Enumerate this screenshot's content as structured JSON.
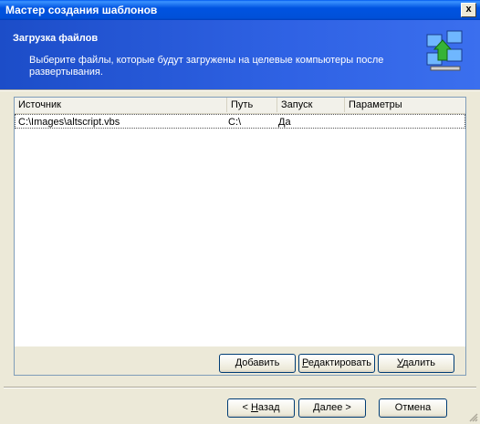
{
  "window": {
    "title": "Мастер создания шаблонов",
    "close_label": "x"
  },
  "header": {
    "title": "Загрузка файлов",
    "description": "Выберите файлы, которые будут загружены на целевые компьютеры после развертывания."
  },
  "table": {
    "columns": [
      "Источник",
      "Путь",
      "Запуск",
      "Параметры"
    ],
    "rows": [
      {
        "source": "C:\\Images\\altscript.vbs",
        "path": "C:\\",
        "run": "Да",
        "params": ""
      }
    ]
  },
  "panel_buttons": {
    "add": {
      "accel": "Д",
      "rest": "обавить"
    },
    "edit": {
      "accel": "Р",
      "rest": "едактировать"
    },
    "delete": {
      "accel": "У",
      "rest": "далить"
    }
  },
  "nav_buttons": {
    "back": {
      "prefix": "< ",
      "accel": "Н",
      "rest": "азад"
    },
    "next": {
      "accel": "Д",
      "rest": "алее >"
    },
    "cancel": "Отмена"
  }
}
